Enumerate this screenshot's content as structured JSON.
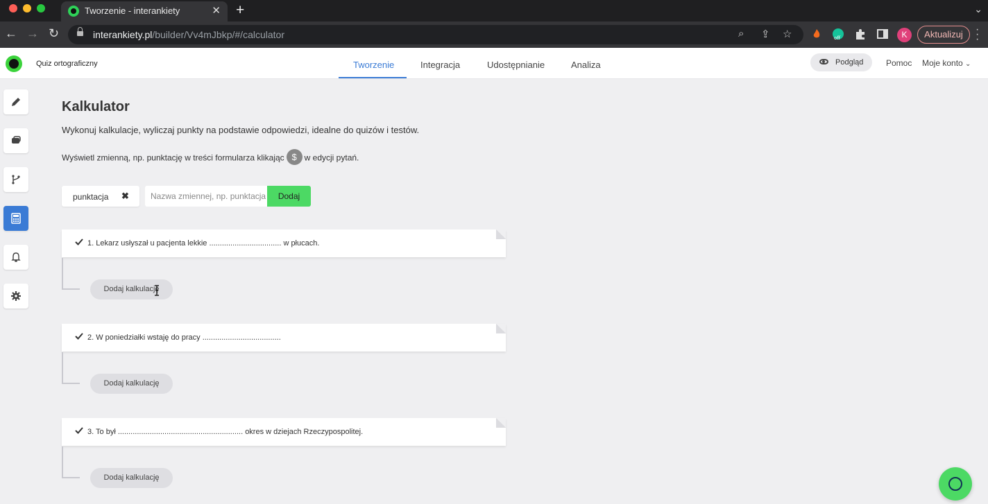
{
  "browser": {
    "tab_title": "Tworzenie - interankiety",
    "url_host": "interankiety.pl",
    "url_path": "/builder/Vv4mJbkp/#/calculator",
    "profile_initial": "K",
    "update_label": "Aktualizuj",
    "extension_badge": "off"
  },
  "header": {
    "form_name": "Quiz ortograficzny",
    "tabs": [
      "Tworzenie",
      "Integracja",
      "Udostępnianie",
      "Analiza"
    ],
    "active_tab": "Tworzenie",
    "preview_label": "Podgląd",
    "help_label": "Pomoc",
    "account_label": "Moje konto"
  },
  "sidebar": {
    "items": [
      "pencil-icon",
      "message-icon",
      "branch-icon",
      "calculator-icon",
      "bell-icon",
      "gear-icon"
    ],
    "active_item": "calculator-icon"
  },
  "main": {
    "title": "Kalkulator",
    "description": "Wykonuj kalkulacje, wyliczaj punkty na podstawie odpowiedzi, idealne do quizów i testów.",
    "hint_before": "Wyświetl zmienną, np. punktację w treści formularza klikając",
    "hint_icon": "$",
    "hint_after": "w edycji pytań.",
    "variable_chip": "punktacja",
    "variable_input_placeholder": "Nazwa zmiennej, np. punktacja",
    "add_button": "Dodaj",
    "questions": [
      {
        "text": "1. Lekarz usłyszał u pacjenta lekkie .................................. w płucach.",
        "calc_button": "Dodaj kalkulację"
      },
      {
        "text": "2. W poniedziałki wstaję do pracy .....................................",
        "calc_button": "Dodaj kalkulację"
      },
      {
        "text": "3. To był ........................................................... okres w dziejach Rzeczypospolitej.",
        "calc_button": "Dodaj kalkulację"
      }
    ]
  },
  "colors": {
    "accent": "#3a7bd5",
    "brand_green": "#4cd964",
    "active_sidebar": "#3a7bd5"
  }
}
